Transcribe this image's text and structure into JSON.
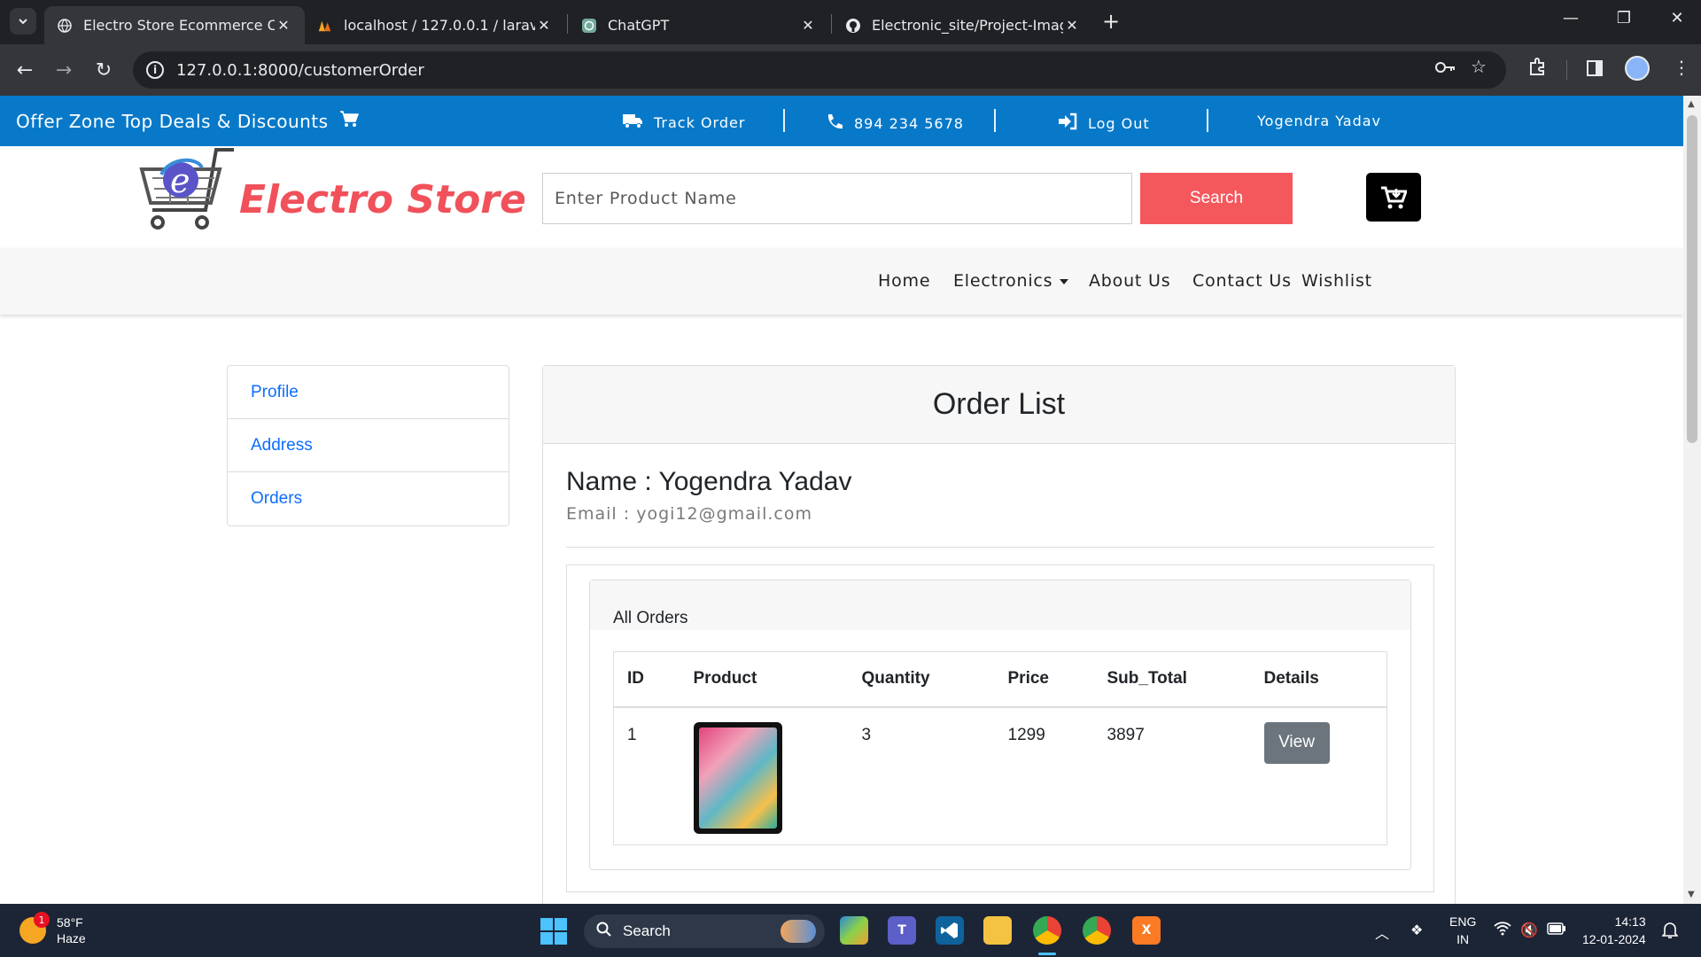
{
  "browser": {
    "tabs": [
      {
        "title": "Electro Store Ecommerce Categ",
        "icon": "globe-icon",
        "active": true
      },
      {
        "title": "localhost / 127.0.0.1 / laravel / c",
        "icon": "phpmyadmin-icon",
        "active": false
      },
      {
        "title": "ChatGPT",
        "icon": "chatgpt-icon",
        "active": false
      },
      {
        "title": "Electronic_site/Project-Images a",
        "icon": "github-icon",
        "active": false
      }
    ],
    "url": "127.0.0.1:8000/customerOrder"
  },
  "topstrip": {
    "offer": "Offer Zone Top Deals & Discounts",
    "track_order": "Track Order",
    "phone": "894 234 5678",
    "logout": "Log Out",
    "user": "Yogendra Yadav"
  },
  "header": {
    "logo_text": "Electro Store",
    "search_placeholder": "Enter Product Name",
    "search_button": "Search"
  },
  "nav": {
    "home": "Home",
    "electronics": "Electronics",
    "about": "About Us",
    "contact": "Contact Us",
    "wishlist": "Wishlist"
  },
  "sidebar": {
    "items": [
      {
        "label": "Profile"
      },
      {
        "label": "Address"
      },
      {
        "label": "Orders"
      }
    ]
  },
  "main": {
    "title": "Order List",
    "name_line": "Name : Yogendra Yadav",
    "email_line": "Email : yogi12@gmail.com",
    "orders_heading": "All Orders",
    "columns": [
      "ID",
      "Product",
      "Quantity",
      "Price",
      "Sub_Total",
      "Details"
    ],
    "rows": [
      {
        "id": "1",
        "product_icon": "tablet-image",
        "quantity": "3",
        "price": "1299",
        "sub_total": "3897",
        "details_label": "View"
      }
    ]
  },
  "taskbar": {
    "weather_temp": "58°F",
    "weather_desc": "Haze",
    "weather_badge": "1",
    "search_label": "Search",
    "lang_top": "ENG",
    "lang_bottom": "IN",
    "time": "14:13",
    "date": "12-01-2024"
  },
  "colors": {
    "topstrip": "#0879c9",
    "logo_red": "#f0515a",
    "search_button": "#f4585d",
    "link_blue": "#0d6efd",
    "view_button": "#6c757d"
  }
}
